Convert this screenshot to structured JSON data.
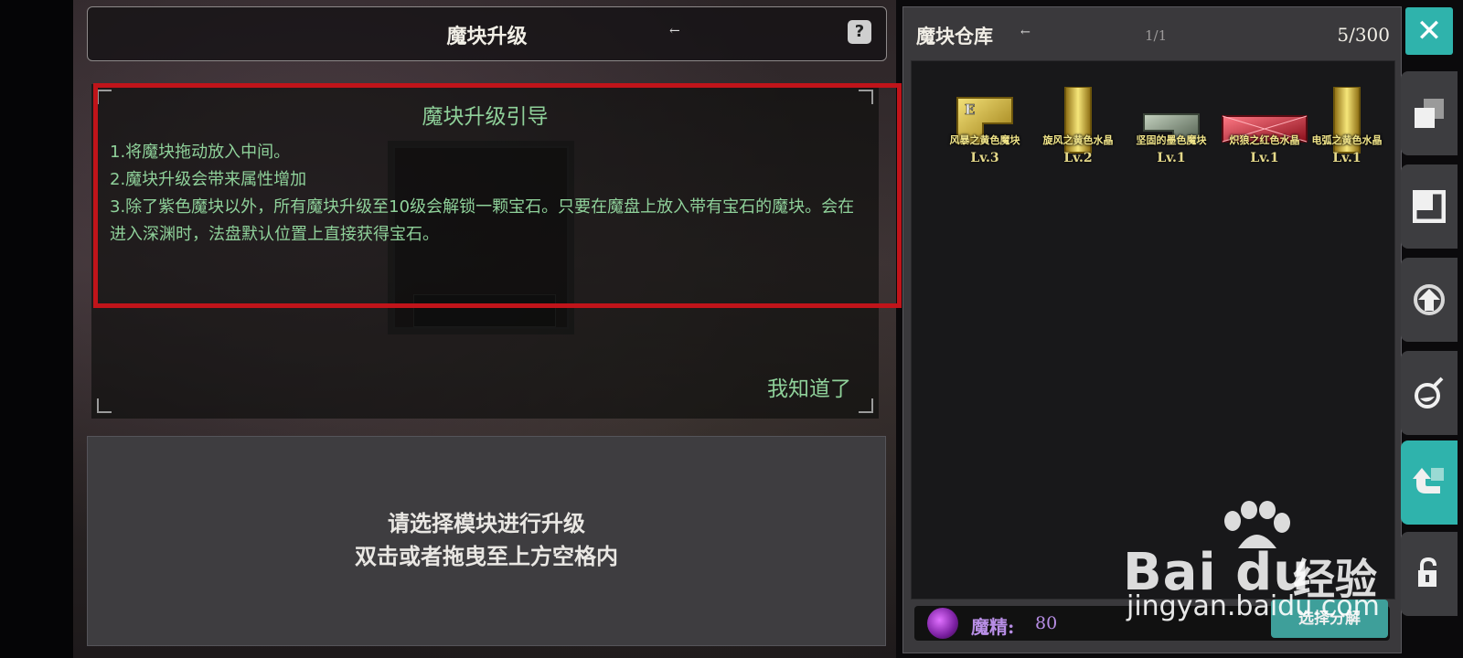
{
  "header": {
    "title": "魔块升级",
    "arrow_left": "→",
    "arrow_right": "←",
    "help_icon": "?"
  },
  "guide": {
    "title": "魔块升级引导",
    "lines": [
      "1.将魔块拖动放入中间。",
      "2.魔块升级会带来属性增加",
      "3.除了紫色魔块以外，所有魔块升级至10级会解锁一颗宝石。只要在魔盘上放入带有宝石的魔块。会在进入深渊时，法盘默认位置上直接获得宝石。"
    ],
    "confirm_label": "我知道了"
  },
  "prompt": {
    "line1": "请选择模块进行升级",
    "line2": "双击或者拖曳至上方空格内"
  },
  "inventory": {
    "title": "魔块仓库",
    "arrow": "←",
    "page": "1/1",
    "count": "5/300",
    "items": [
      {
        "name": "风暴之黄色魔块",
        "level": "Lv.3",
        "badge": "E",
        "color": "#d8b93a"
      },
      {
        "name": "旋风之黄色水晶",
        "level": "Lv.2",
        "color": "#e2c640"
      },
      {
        "name": "坚固的墨色魔块",
        "level": "Lv.1",
        "color": "#8ea28a"
      },
      {
        "name": "炽狼之红色水晶",
        "level": "Lv.1",
        "color": "#d8283a"
      },
      {
        "name": "电弧之黄色水晶",
        "level": "Lv.1",
        "color": "#e2c640"
      }
    ],
    "essence_label": "魔精:",
    "essence_value": "80",
    "decompose_label": "选择分解"
  },
  "sidebar": {
    "close_icon": "✕",
    "buttons": [
      {
        "icon": "stack-icon",
        "active": false
      },
      {
        "icon": "frame-icon",
        "active": false
      },
      {
        "icon": "upgrade-arrow-icon",
        "active": false
      },
      {
        "icon": "potion-icon",
        "active": false
      },
      {
        "icon": "curved-arrow-icon",
        "active": true
      },
      {
        "icon": "unlock-icon",
        "active": false
      }
    ]
  },
  "watermark": {
    "brand": "Bai du",
    "brand_cn": "经验",
    "url": "jingyan.baidu.com"
  }
}
